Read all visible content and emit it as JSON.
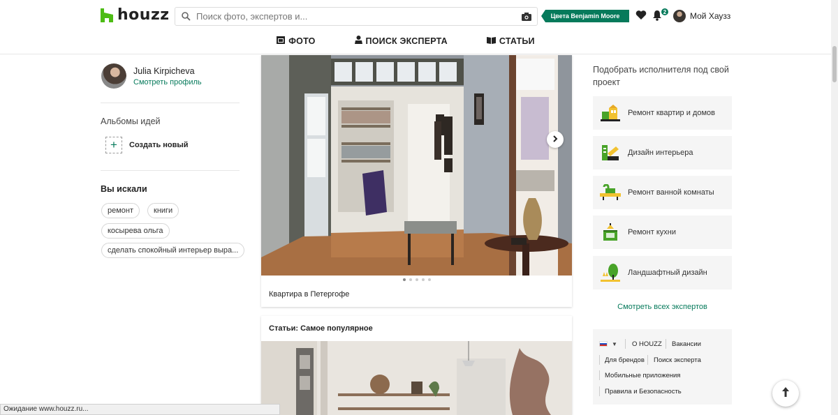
{
  "brand": {
    "name": "houzz",
    "color": "#067a5b"
  },
  "header": {
    "search_placeholder": "Поиск фото, экспертов и...",
    "promo_label": "Цвета Benjamin Moore",
    "notifications_count": "2",
    "my_houzz": "Мой Хаузз"
  },
  "nav": {
    "photos": "ФОТО",
    "find_pro": "ПОИСК ЭКСПЕРТА",
    "articles": "СТАТЬИ"
  },
  "sidebar": {
    "user_name": "Julia Kirpicheva",
    "view_profile": "Смотреть профиль",
    "albums_title": "Альбомы идей",
    "create_new": "Создать новый",
    "searched_title": "Вы искали",
    "tags": [
      "ремонт",
      "книги",
      "косырева ольга",
      "сделать спокойный интерьер выра..."
    ]
  },
  "main": {
    "photo_caption": "Квартира в Петергофе",
    "carousel_total": 5,
    "carousel_active": 1,
    "articles_title": "Статьи: Самое популярное"
  },
  "right": {
    "title": "Подобрать исполнителя под свой проект",
    "services": [
      {
        "label": "Ремонт квартир и домов",
        "icon": "house-renovation-icon"
      },
      {
        "label": "Дизайн интерьера",
        "icon": "interior-design-icon"
      },
      {
        "label": "Ремонт ванной комнаты",
        "icon": "bathroom-icon"
      },
      {
        "label": "Ремонт кухни",
        "icon": "kitchen-icon"
      },
      {
        "label": "Ландшафтный дизайн",
        "icon": "landscape-icon"
      }
    ],
    "see_all": "Смотреть всех экспертов",
    "footer": {
      "about": "О HOUZZ",
      "jobs": "Вакансии",
      "brands": "Для брендов",
      "find_pro": "Поиск эксперта",
      "mobile": "Мобильные приложения",
      "rules": "Правила и Безопасность"
    }
  },
  "status_bar": "Ожидание www.houzz.ru..."
}
